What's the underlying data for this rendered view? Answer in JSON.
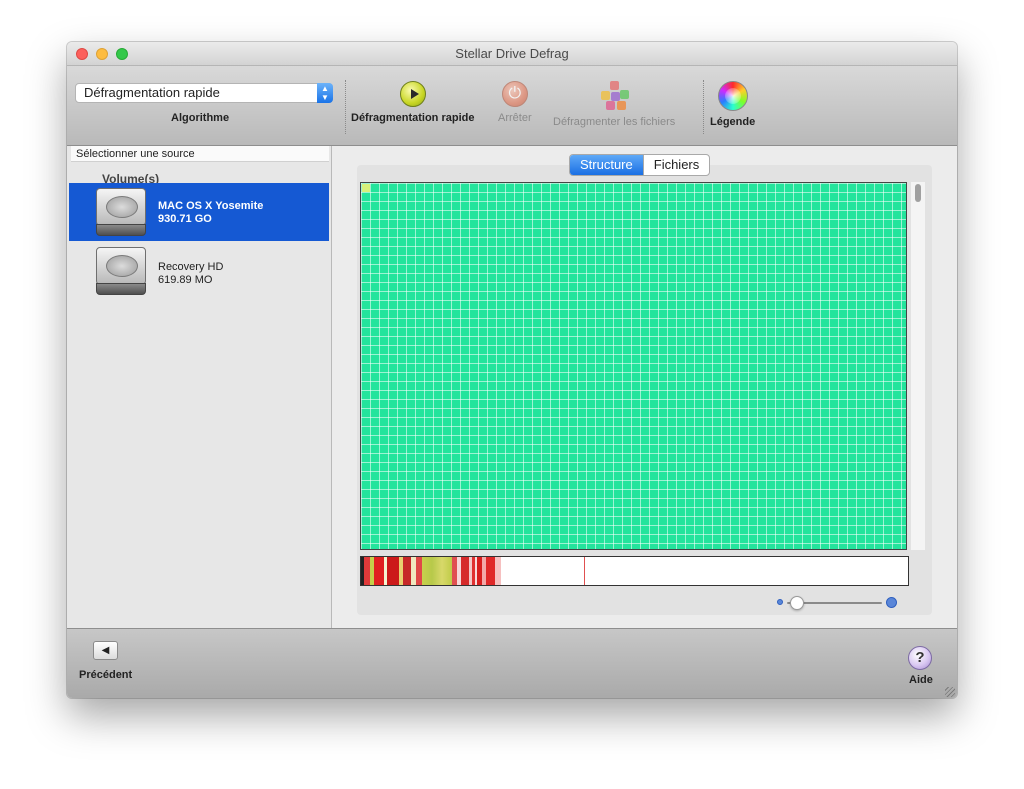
{
  "window": {
    "title": "Stellar Drive Defrag"
  },
  "toolbar": {
    "algorithm_value": "Défragmentation rapide",
    "algorithm_label": "Algorithme",
    "quick_defrag_label": "Défragmentation rapide",
    "stop_label": "Arrêter",
    "defrag_files_label": "Défragmenter les fichiers",
    "legend_label": "Légende"
  },
  "sidebar": {
    "header": "Sélectionner une source",
    "group_label": "Volume(s)",
    "volumes": [
      {
        "name": "MAC OS X Yosemite",
        "size": "930.71 GO",
        "selected": true
      },
      {
        "name": "Recovery HD",
        "size": "619.89 MO",
        "selected": false
      }
    ]
  },
  "main": {
    "tabs": [
      {
        "label": "Structure",
        "active": true
      },
      {
        "label": "Fichiers",
        "active": false
      }
    ],
    "map_color": "#23e49c",
    "zoom_level_fraction": 0.1
  },
  "footer": {
    "back_label": "Précédent",
    "help_label": "Aide"
  },
  "colors": {
    "selection": "#1559d3",
    "accent": "#1a6fe4"
  }
}
